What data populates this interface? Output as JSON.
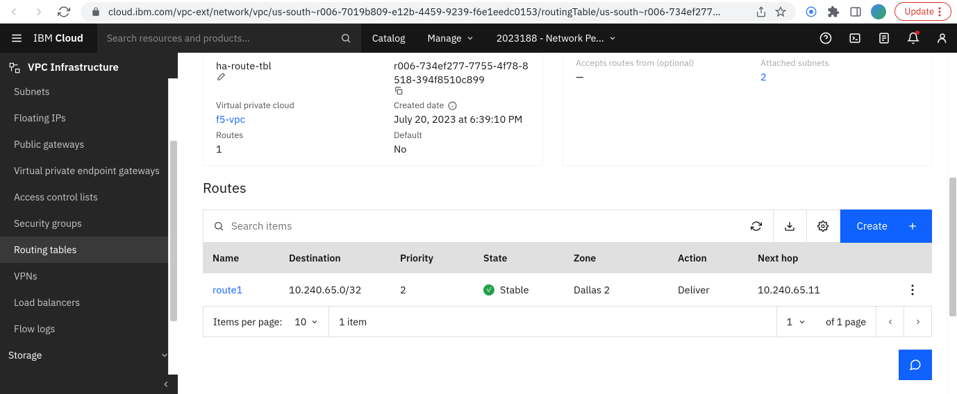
{
  "browser": {
    "url": "cloud.ibm.com/vpc-ext/network/vpc/us-south~r006-7019b809-e12b-4459-9239-f6e1eedc0153/routingTable/us-south~r006-734ef277...",
    "update_label": "Update"
  },
  "header": {
    "brand_prefix": "IBM",
    "brand_bold": "Cloud",
    "search_placeholder": "Search resources and products...",
    "catalog": "Catalog",
    "manage": "Manage",
    "account": "2023188 - Network Pe..."
  },
  "sidebar": {
    "title": "VPC Infrastructure",
    "items": [
      {
        "label": "Subnets"
      },
      {
        "label": "Floating IPs"
      },
      {
        "label": "Public gateways"
      },
      {
        "label": "Virtual private endpoint gateways"
      },
      {
        "label": "Access control lists"
      },
      {
        "label": "Security groups"
      },
      {
        "label": "Routing tables"
      },
      {
        "label": "VPNs"
      },
      {
        "label": "Load balancers"
      },
      {
        "label": "Flow logs"
      }
    ],
    "section_storage": "Storage"
  },
  "details": {
    "name_value": "ha-route-tbl",
    "id_value_line1": "r006-734ef277-7755-4f78-8",
    "id_value_line2": "518-394f8510c899",
    "vpc_label": "Virtual private cloud",
    "vpc_value": "f5-vpc",
    "created_label": "Created date",
    "created_value": "July 20, 2023 at 6:39:10 PM",
    "routes_label": "Routes",
    "routes_value": "1",
    "default_label": "Default",
    "default_value": "No",
    "accepts_label": "Accepts routes from (optional)",
    "accepts_value": "—",
    "subnets_label": "Attached subnets",
    "subnets_value": "2"
  },
  "routes": {
    "title": "Routes",
    "search_placeholder": "Search items",
    "create_label": "Create",
    "columns": {
      "name": "Name",
      "destination": "Destination",
      "priority": "Priority",
      "state": "State",
      "zone": "Zone",
      "action": "Action",
      "nexthop": "Next hop"
    },
    "rows": [
      {
        "name": "route1",
        "destination": "10.240.65.0/32",
        "priority": "2",
        "state": "Stable",
        "zone": "Dallas 2",
        "action": "Deliver",
        "nexthop": "10.240.65.11"
      }
    ],
    "pager": {
      "items_per_page_label": "Items per page:",
      "items_per_page_value": "10",
      "item_count": "1 item",
      "page_current": "1",
      "page_of": "of 1 page"
    }
  }
}
